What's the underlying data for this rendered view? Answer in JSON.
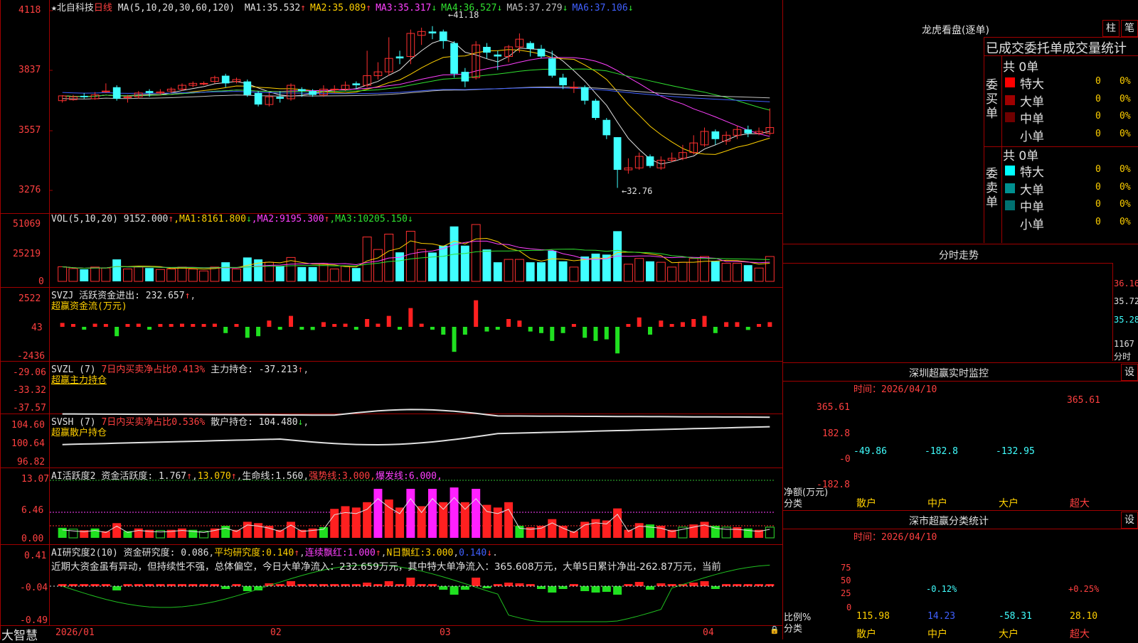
{
  "brand": "大智慧",
  "chart_header": {
    "star": "★",
    "stock_name": "北自科技",
    "period": "日线",
    "ma_label": "MA(5,10,20,30,60,120)",
    "ma": [
      {
        "label": "MA1:",
        "value": "35.532",
        "arrow": "↑",
        "color": "#e0e0e0"
      },
      {
        "label": "MA2:",
        "value": "35.089",
        "arrow": "↑",
        "color": "#ffd000"
      },
      {
        "label": "MA3:",
        "value": "35.317",
        "arrow": "↓",
        "color": "#ff40ff"
      },
      {
        "label": "MA4:",
        "value": "36.527",
        "arrow": "↓",
        "color": "#30e030"
      },
      {
        "label": "MA5:",
        "value": "37.279",
        "arrow": "↓",
        "color": "#c0c0c0"
      },
      {
        "label": "MA6:",
        "value": "37.106",
        "arrow": "↓",
        "color": "#4060ff"
      }
    ]
  },
  "price_axis": [
    "4118",
    "3837",
    "3557",
    "3276"
  ],
  "price_marks": {
    "high": "41.18",
    "low": "32.76"
  },
  "vol_panel": {
    "label": "VOL(5,10,20)",
    "value": "9152.000",
    "arrow": "↑",
    "ma": [
      {
        "label": "MA1:",
        "value": "8161.800",
        "arrow": "↓",
        "color": "#ffd000"
      },
      {
        "label": "MA2:",
        "value": "9195.300",
        "arrow": "↑",
        "color": "#ff40ff"
      },
      {
        "label": "MA3:",
        "value": "10205.150",
        "arrow": "↓",
        "color": "#30e030"
      }
    ],
    "axis": [
      "51069",
      "25219",
      "0"
    ]
  },
  "svzj_panel": {
    "label": "SVZJ",
    "name": "活跃资金进出:",
    "value": "232.657",
    "arrow": "↑",
    "sub": "超赢资金流(万元)",
    "axis": [
      "2522",
      "43",
      "-2436"
    ]
  },
  "svzl_panel": {
    "label": "SVZL (7)",
    "ratio": "7日内买卖净占比0.413%",
    "name": "主力持仓:",
    "value": "-37.213",
    "arrow": "↑",
    "sub": "超赢主力持仓",
    "axis": [
      "-29.06",
      "-33.32",
      "-37.57"
    ]
  },
  "svsh_panel": {
    "label": "SVSH (7)",
    "ratio": "7日内买卖净占比0.536%",
    "name": "散户持仓:",
    "value": "104.480",
    "arrow": "↓",
    "sub": "超赢散户持仓",
    "axis": [
      "104.60",
      "100.64",
      "96.82"
    ]
  },
  "ai_active_panel": {
    "label": "AI活跃度2",
    "name": "资金活跃度:",
    "value": "1.767",
    "v2": "13.070",
    "life": "生命线:",
    "life_value": "1.560",
    "strong": "强势线:",
    "strong_value": "3.000",
    "burst": "爆发线:",
    "burst_value": "6.000",
    "axis": [
      "13.07",
      "6.46",
      "0.00"
    ]
  },
  "ai_research_panel": {
    "label": "AI研究度2(10)",
    "name": "资金研究度:",
    "value": "0.086",
    "avg": "平均研究度:",
    "avg_value": "0.140",
    "cont": "连续飘红:",
    "cont_value": "1.000",
    "nday": "N日飘红:",
    "nday_value": "3.000",
    "last": "0.140",
    "comment": "近期大资金虽有异动，但持续性不强，总体偏空，今日大单净流入：232.659万元，其中特大单净流入：365.608万元，大单5日累计净出-262.87万元，当前",
    "axis": [
      "0.41",
      "-0.04",
      "-0.49"
    ]
  },
  "date_axis": [
    "2026/01",
    "02",
    "03",
    "04"
  ],
  "dragon": {
    "title": "龙虎看盘(逐单)",
    "btn_zhu": "柱",
    "btn_bi": "笔",
    "header": "已成交委托单成交量统计",
    "buy_label": "委买单",
    "sell_label": "委卖单",
    "buy_total": "共 0单",
    "sell_total": "共 0单",
    "buy_rows": [
      {
        "name": "特大",
        "count": "0",
        "pct": "0%",
        "color": "#ff0000"
      },
      {
        "name": "大单",
        "count": "0",
        "pct": "0%",
        "color": "#a00000"
      },
      {
        "name": "中单",
        "count": "0",
        "pct": "0%",
        "color": "#700000"
      },
      {
        "name": "小单",
        "count": "0",
        "pct": "0%",
        "color": "#000000"
      }
    ],
    "sell_rows": [
      {
        "name": "特大",
        "count": "0",
        "pct": "0%",
        "color": "#00ffff"
      },
      {
        "name": "大单",
        "count": "0",
        "pct": "0%",
        "color": "#009090"
      },
      {
        "name": "中单",
        "count": "0",
        "pct": "0%",
        "color": "#007070"
      },
      {
        "name": "小单",
        "count": "0",
        "pct": "0%",
        "color": "#000000"
      }
    ]
  },
  "intraday": {
    "title": "分时走势",
    "axis": [
      "36.16",
      "35.72",
      "35.28"
    ],
    "vol_axis": "1167",
    "vol_label": "分时"
  },
  "monitor": {
    "title": "深圳超赢实时监控",
    "btn": "设",
    "time_label": "时间：",
    "time": "2026/04/10",
    "axis": [
      "365.61",
      "182.8",
      "-0",
      "-182.8"
    ],
    "net_label": "净额(万元)",
    "cat_label": "分类",
    "cats": [
      "散户",
      "中户",
      "大户",
      "超大"
    ],
    "values": [
      "-49.86",
      "-182.8",
      "-132.95",
      "365.61"
    ]
  },
  "classify": {
    "title": "深市超赢分类统计",
    "btn": "设",
    "time_label": "时间：",
    "time": "2026/04/10",
    "axis": [
      "75",
      "50",
      "25",
      "0"
    ],
    "ratio_label": "比例%",
    "cat_label": "分类",
    "cats": [
      "散户",
      "中户",
      "大户",
      "超大"
    ],
    "pct": [
      "",
      "-0.12%",
      "",
      "+0.25%"
    ],
    "values": [
      "115.98",
      "14.23",
      "-58.31",
      "28.10"
    ]
  },
  "chart_data": {
    "type": "candlestick",
    "price_scale": [
      32.0,
      41.8
    ],
    "candles": [
      [
        37.3,
        37.55,
        37.58,
        37.2
      ],
      [
        37.35,
        37.5,
        37.6,
        37.3
      ],
      [
        37.55,
        37.48,
        37.7,
        37.4
      ],
      [
        37.4,
        37.6,
        37.75,
        37.35
      ],
      [
        37.8,
        37.8,
        38.2,
        37.7
      ],
      [
        38.0,
        37.4,
        38.1,
        37.3
      ],
      [
        37.5,
        37.5,
        37.6,
        37.2
      ],
      [
        37.5,
        37.7,
        37.8,
        37.4
      ],
      [
        37.8,
        37.7,
        37.9,
        37.5
      ],
      [
        37.7,
        37.75,
        37.9,
        37.6
      ],
      [
        37.8,
        37.9,
        38.0,
        37.7
      ],
      [
        37.9,
        38.1,
        38.2,
        37.8
      ],
      [
        38.1,
        38.2,
        38.3,
        38.0
      ],
      [
        38.2,
        38.2,
        38.3,
        38.1
      ],
      [
        38.3,
        38.5,
        38.6,
        38.2
      ],
      [
        38.6,
        38.2,
        38.7,
        38.0
      ],
      [
        38.3,
        38.4,
        38.5,
        38.2
      ],
      [
        38.3,
        37.6,
        38.4,
        37.5
      ],
      [
        37.7,
        37.1,
        37.8,
        37.0
      ],
      [
        37.1,
        37.5,
        37.7,
        37.0
      ],
      [
        37.5,
        37.4,
        37.8,
        37.2
      ],
      [
        37.4,
        38.1,
        38.2,
        37.3
      ],
      [
        37.9,
        37.8,
        38.0,
        37.5
      ],
      [
        37.8,
        37.6,
        37.9,
        37.5
      ],
      [
        37.6,
        37.9,
        38.1,
        37.5
      ],
      [
        37.9,
        37.9,
        38.1,
        37.7
      ],
      [
        37.9,
        38.1,
        38.3,
        37.8
      ],
      [
        38.2,
        38.1,
        38.3,
        37.9
      ],
      [
        38.1,
        38.6,
        39.9,
        38.0
      ],
      [
        38.6,
        38.8,
        39.3,
        38.4
      ],
      [
        38.8,
        39.5,
        40.6,
        38.6
      ],
      [
        39.6,
        39.5,
        39.9,
        39.2
      ],
      [
        39.6,
        40.8,
        41.0,
        39.2
      ],
      [
        40.7,
        40.9,
        41.1,
        40.2
      ],
      [
        40.9,
        40.8,
        41.18,
        40.5
      ],
      [
        40.9,
        40.4,
        41.0,
        40.0
      ],
      [
        40.3,
        38.7,
        40.4,
        38.5
      ],
      [
        38.8,
        38.3,
        39.0,
        38.0
      ],
      [
        38.5,
        40.2,
        40.4,
        38.4
      ],
      [
        40.1,
        39.8,
        40.3,
        39.5
      ],
      [
        39.7,
        39.6,
        39.9,
        38.9
      ],
      [
        39.6,
        40.1,
        40.2,
        39.3
      ],
      [
        40.1,
        40.5,
        40.8,
        39.8
      ],
      [
        40.3,
        40.0,
        40.4,
        39.6
      ],
      [
        40.0,
        39.6,
        40.2,
        39.5
      ],
      [
        39.5,
        38.6,
        39.9,
        38.5
      ],
      [
        38.5,
        38.1,
        38.7,
        37.9
      ],
      [
        38.0,
        38.0,
        38.3,
        37.7
      ],
      [
        38.0,
        37.3,
        38.1,
        37.1
      ],
      [
        37.3,
        36.4,
        37.4,
        36.3
      ],
      [
        36.3,
        35.5,
        36.4,
        35.3
      ],
      [
        35.4,
        33.7,
        35.4,
        32.76
      ],
      [
        33.7,
        33.8,
        34.3,
        33.5
      ],
      [
        33.8,
        34.4,
        34.6,
        33.7
      ],
      [
        34.4,
        33.9,
        34.5,
        33.8
      ],
      [
        33.8,
        34.2,
        34.4,
        33.7
      ],
      [
        34.2,
        34.3,
        34.6,
        34.1
      ],
      [
        34.3,
        34.6,
        35.0,
        34.2
      ],
      [
        34.6,
        35.1,
        35.5,
        34.5
      ],
      [
        35.0,
        35.7,
        35.9,
        34.9
      ],
      [
        35.7,
        35.3,
        35.8,
        35.0
      ],
      [
        35.2,
        35.5,
        35.7,
        35.0
      ],
      [
        35.5,
        35.8,
        36.0,
        35.3
      ],
      [
        35.8,
        35.6,
        36.0,
        35.4
      ],
      [
        35.6,
        35.7,
        35.9,
        35.5
      ],
      [
        35.6,
        35.9,
        36.9,
        35.5
      ]
    ]
  }
}
